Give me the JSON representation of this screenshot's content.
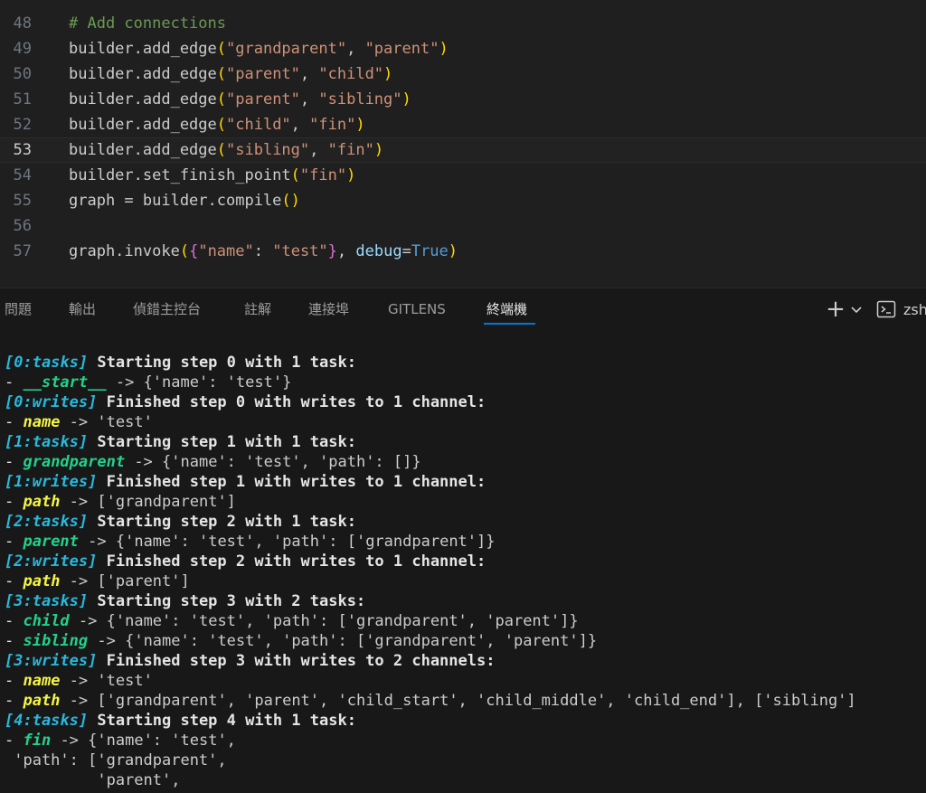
{
  "editor": {
    "lines": [
      {
        "num": "48",
        "segments": [
          {
            "t": "# Add connections",
            "c": "c-comment"
          }
        ]
      },
      {
        "num": "49",
        "segments": [
          {
            "t": "builder.add_edge"
          },
          {
            "t": "(",
            "c": "c-paren"
          },
          {
            "t": "\"grandparent\"",
            "c": "c-str"
          },
          {
            "t": ", "
          },
          {
            "t": "\"parent\"",
            "c": "c-str"
          },
          {
            "t": ")",
            "c": "c-paren"
          }
        ]
      },
      {
        "num": "50",
        "segments": [
          {
            "t": "builder.add_edge"
          },
          {
            "t": "(",
            "c": "c-paren"
          },
          {
            "t": "\"parent\"",
            "c": "c-str"
          },
          {
            "t": ", "
          },
          {
            "t": "\"child\"",
            "c": "c-str"
          },
          {
            "t": ")",
            "c": "c-paren"
          }
        ]
      },
      {
        "num": "51",
        "segments": [
          {
            "t": "builder.add_edge"
          },
          {
            "t": "(",
            "c": "c-paren"
          },
          {
            "t": "\"parent\"",
            "c": "c-str"
          },
          {
            "t": ", "
          },
          {
            "t": "\"sibling\"",
            "c": "c-str"
          },
          {
            "t": ")",
            "c": "c-paren"
          }
        ]
      },
      {
        "num": "52",
        "segments": [
          {
            "t": "builder.add_edge"
          },
          {
            "t": "(",
            "c": "c-paren"
          },
          {
            "t": "\"child\"",
            "c": "c-str"
          },
          {
            "t": ", "
          },
          {
            "t": "\"fin\"",
            "c": "c-str"
          },
          {
            "t": ")",
            "c": "c-paren"
          }
        ]
      },
      {
        "num": "53",
        "active": true,
        "segments": [
          {
            "t": "builder.add_edge"
          },
          {
            "t": "(",
            "c": "c-paren"
          },
          {
            "t": "\"sibling\"",
            "c": "c-str"
          },
          {
            "t": ", "
          },
          {
            "t": "\"fin\"",
            "c": "c-str"
          },
          {
            "t": ")",
            "c": "c-paren"
          }
        ]
      },
      {
        "num": "54",
        "segments": [
          {
            "t": "builder.set_finish_point"
          },
          {
            "t": "(",
            "c": "c-paren"
          },
          {
            "t": "\"fin\"",
            "c": "c-str"
          },
          {
            "t": ")",
            "c": "c-paren"
          }
        ]
      },
      {
        "num": "55",
        "segments": [
          {
            "t": "graph = builder.compile"
          },
          {
            "t": "()",
            "c": "c-paren"
          }
        ]
      },
      {
        "num": "56",
        "segments": []
      },
      {
        "num": "57",
        "segments": [
          {
            "t": "graph.invoke"
          },
          {
            "t": "(",
            "c": "c-paren"
          },
          {
            "t": "{",
            "c": "c-brace"
          },
          {
            "t": "\"name\"",
            "c": "c-str"
          },
          {
            "t": ": "
          },
          {
            "t": "\"test\"",
            "c": "c-str"
          },
          {
            "t": "}",
            "c": "c-brace"
          },
          {
            "t": ", "
          },
          {
            "t": "debug",
            "c": "c-param"
          },
          {
            "t": "="
          },
          {
            "t": "True",
            "c": "c-kw"
          },
          {
            "t": ")",
            "c": "c-paren"
          }
        ]
      }
    ]
  },
  "panel": {
    "tabs": [
      {
        "label": "問題",
        "name": "tab-problems"
      },
      {
        "label": "輸出",
        "name": "tab-output"
      },
      {
        "label": "偵錯主控台",
        "name": "tab-debug-console"
      },
      {
        "label": "註解",
        "name": "tab-comments"
      },
      {
        "label": "連接埠",
        "name": "tab-ports"
      },
      {
        "label": "GITLENS",
        "name": "tab-gitlens"
      },
      {
        "label": "終端機",
        "name": "tab-terminal",
        "active": true
      }
    ],
    "terminal_name": "zsh",
    "icons": {
      "new_terminal": "plus-icon",
      "dropdown": "chevron-down-icon",
      "terminal": "terminal-icon"
    }
  },
  "terminal": {
    "lines": [
      [
        {
          "t": "[0:tasks]",
          "c": "t-tag"
        },
        {
          "t": " Starting step 0 with 1 task:",
          "c": "t-head"
        }
      ],
      [
        {
          "t": "- ",
          "c": "t-dash"
        },
        {
          "t": "__start__",
          "c": "t-node"
        },
        {
          "t": " -> ",
          "c": "t-arrow"
        },
        {
          "t": "{'name': 'test'}",
          "c": "t-val"
        }
      ],
      [
        {
          "t": "[0:writes]",
          "c": "t-tag"
        },
        {
          "t": " Finished step 0 with writes to 1 channel:",
          "c": "t-head"
        }
      ],
      [
        {
          "t": "- ",
          "c": "t-dash"
        },
        {
          "t": "name",
          "c": "t-chan"
        },
        {
          "t": " -> ",
          "c": "t-arrow"
        },
        {
          "t": "'test'",
          "c": "t-val"
        }
      ],
      [
        {
          "t": "[1:tasks]",
          "c": "t-tag"
        },
        {
          "t": " Starting step 1 with 1 task:",
          "c": "t-head"
        }
      ],
      [
        {
          "t": "- ",
          "c": "t-dash"
        },
        {
          "t": "grandparent",
          "c": "t-node"
        },
        {
          "t": " -> ",
          "c": "t-arrow"
        },
        {
          "t": "{'name': 'test', 'path': []}",
          "c": "t-val"
        }
      ],
      [
        {
          "t": "[1:writes]",
          "c": "t-tag"
        },
        {
          "t": " Finished step 1 with writes to 1 channel:",
          "c": "t-head"
        }
      ],
      [
        {
          "t": "- ",
          "c": "t-dash"
        },
        {
          "t": "path",
          "c": "t-chan"
        },
        {
          "t": " -> ",
          "c": "t-arrow"
        },
        {
          "t": "['grandparent']",
          "c": "t-val"
        }
      ],
      [
        {
          "t": "[2:tasks]",
          "c": "t-tag"
        },
        {
          "t": " Starting step 2 with 1 task:",
          "c": "t-head"
        }
      ],
      [
        {
          "t": "- ",
          "c": "t-dash"
        },
        {
          "t": "parent",
          "c": "t-node"
        },
        {
          "t": " -> ",
          "c": "t-arrow"
        },
        {
          "t": "{'name': 'test', 'path': ['grandparent']}",
          "c": "t-val"
        }
      ],
      [
        {
          "t": "[2:writes]",
          "c": "t-tag"
        },
        {
          "t": " Finished step 2 with writes to 1 channel:",
          "c": "t-head"
        }
      ],
      [
        {
          "t": "- ",
          "c": "t-dash"
        },
        {
          "t": "path",
          "c": "t-chan"
        },
        {
          "t": " -> ",
          "c": "t-arrow"
        },
        {
          "t": "['parent']",
          "c": "t-val"
        }
      ],
      [
        {
          "t": "[3:tasks]",
          "c": "t-tag"
        },
        {
          "t": " Starting step 3 with 2 tasks:",
          "c": "t-head"
        }
      ],
      [
        {
          "t": "- ",
          "c": "t-dash"
        },
        {
          "t": "child",
          "c": "t-node"
        },
        {
          "t": " -> ",
          "c": "t-arrow"
        },
        {
          "t": "{'name': 'test', 'path': ['grandparent', 'parent']}",
          "c": "t-val"
        }
      ],
      [
        {
          "t": "- ",
          "c": "t-dash"
        },
        {
          "t": "sibling",
          "c": "t-node"
        },
        {
          "t": " -> ",
          "c": "t-arrow"
        },
        {
          "t": "{'name': 'test', 'path': ['grandparent', 'parent']}",
          "c": "t-val"
        }
      ],
      [
        {
          "t": "[3:writes]",
          "c": "t-tag"
        },
        {
          "t": " Finished step 3 with writes to 2 channels:",
          "c": "t-head"
        }
      ],
      [
        {
          "t": "- ",
          "c": "t-dash"
        },
        {
          "t": "name",
          "c": "t-chan"
        },
        {
          "t": " -> ",
          "c": "t-arrow"
        },
        {
          "t": "'test'",
          "c": "t-val"
        }
      ],
      [
        {
          "t": "- ",
          "c": "t-dash"
        },
        {
          "t": "path",
          "c": "t-chan"
        },
        {
          "t": " -> ",
          "c": "t-arrow"
        },
        {
          "t": "['grandparent', 'parent', 'child_start', 'child_middle', 'child_end'], ['sibling']",
          "c": "t-val"
        }
      ],
      [
        {
          "t": "[4:tasks]",
          "c": "t-tag"
        },
        {
          "t": " Starting step 4 with 1 task:",
          "c": "t-head"
        }
      ],
      [
        {
          "t": "- ",
          "c": "t-dash"
        },
        {
          "t": "fin",
          "c": "t-node"
        },
        {
          "t": " -> ",
          "c": "t-arrow"
        },
        {
          "t": "{'name': 'test',",
          "c": "t-val"
        }
      ],
      [
        {
          "t": " 'path': ['grandparent',",
          "c": "t-val"
        }
      ],
      [
        {
          "t": "          'parent',",
          "c": "t-val"
        }
      ]
    ]
  }
}
